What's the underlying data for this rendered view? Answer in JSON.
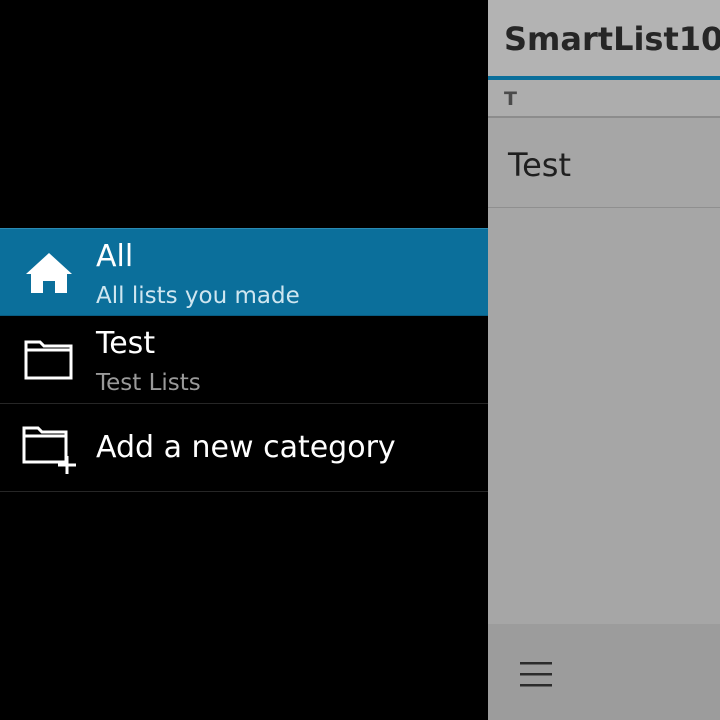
{
  "drawer": {
    "items": [
      {
        "icon": "home-icon",
        "title": "All",
        "subtitle": "All lists you made",
        "selected": true
      },
      {
        "icon": "folder-icon",
        "title": "Test",
        "subtitle": "Test Lists",
        "selected": false
      },
      {
        "icon": "add-folder-icon",
        "title": "Add a new category",
        "selected": false
      }
    ]
  },
  "page": {
    "title": "SmartList10:",
    "section_letter": "T",
    "rows": [
      "Test"
    ],
    "menu_icon": "hamburger-menu-icon"
  },
  "colors": {
    "accent": "#0b6f9b",
    "drawer_bg": "#000000",
    "page_bg": "#a6a6a6"
  }
}
